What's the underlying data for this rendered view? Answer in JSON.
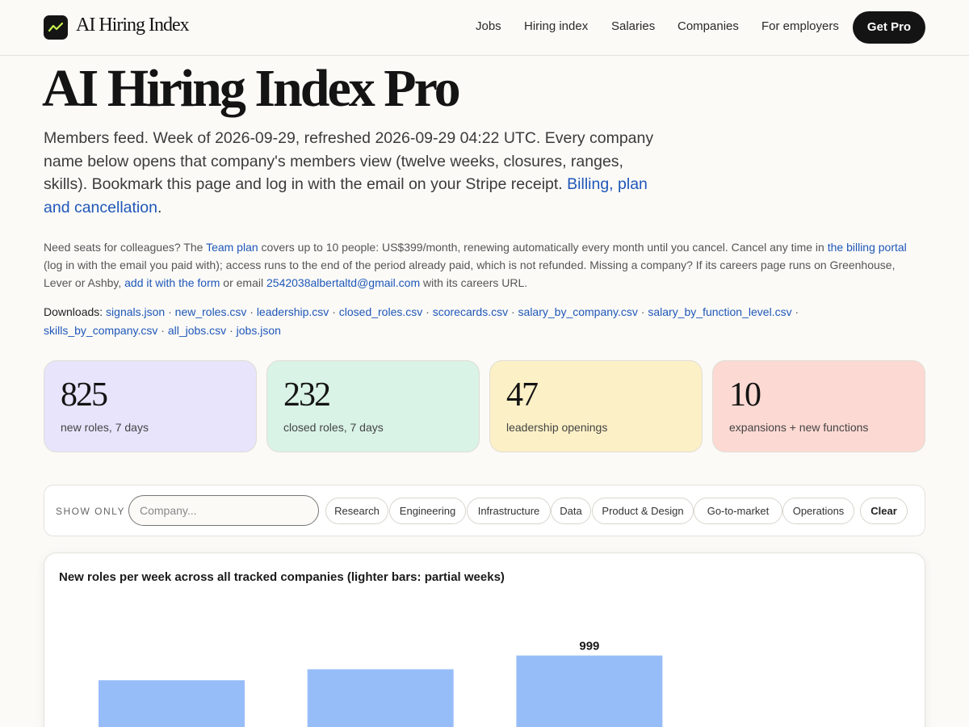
{
  "header": {
    "brand": "AI Hiring Index",
    "nav": [
      "Jobs",
      "Hiring index",
      "Salaries",
      "Companies",
      "For employers"
    ],
    "cta": "Get Pro"
  },
  "page": {
    "title": "AI Hiring Index Pro",
    "lead_text": "Members feed. Week of 2026-09-29, refreshed 2026-09-29 04:22 UTC. Every company name below opens that company's members view (twelve weeks, closures, ranges, skills). Bookmark this page and log in with the email on your Stripe receipt.",
    "lead_link": "Billing, plan and cancellation",
    "lead_end": "."
  },
  "team": {
    "t1": "Need seats for colleagues? The ",
    "team_plan_link": "Team plan",
    "t2": " covers up to 10 people: US$399/month, renewing automatically every month until you cancel. Cancel any time in ",
    "billing_portal_link": "the billing portal",
    "t3": " (log in with the email you paid with); access runs to the end of the period already paid, which is not refunded. Missing a company? If its careers page runs on Greenhouse, Lever or Ashby, ",
    "form_link": "add it with the form",
    "t4": " or email ",
    "email_link": "2542038albertaltd@gmail.com",
    "t5": " with its careers URL."
  },
  "downloads": {
    "label": "Downloads:",
    "files": [
      "signals.json",
      "new_roles.csv",
      "leadership.csv",
      "closed_roles.csv",
      "scorecards.csv",
      "salary_by_company.csv",
      "salary_by_function_level.csv",
      "skills_by_company.csv",
      "all_jobs.csv",
      "jobs.json"
    ],
    "separator": "·"
  },
  "stats": [
    {
      "value": "825",
      "label": "new roles, 7 days",
      "color": "#e7e4fc"
    },
    {
      "value": "232",
      "label": "closed roles, 7 days",
      "color": "#d9f3e6"
    },
    {
      "value": "47",
      "label": "leadership openings",
      "color": "#fcf0c6"
    },
    {
      "value": "10",
      "label": "expansions + new functions",
      "color": "#fdd9d3"
    }
  ],
  "filter": {
    "label": "SHOW ONLY",
    "company_placeholder": "Company...",
    "company_value": "",
    "functions": [
      "Research",
      "Engineering",
      "Infrastructure",
      "Data",
      "Product & Design",
      "Go-to-market",
      "Operations"
    ],
    "clear": "Clear"
  },
  "colors": {
    "accent_link": "#1f57b8",
    "bar_full": "#97bdf9",
    "logo_line": "#c6f24e"
  },
  "chart_data": {
    "type": "bar",
    "title": "New roles per week across all tracked companies (lighter bars: partial weeks)",
    "categories": [],
    "values": [
      770,
      872,
      999
    ],
    "labels": [
      "",
      "",
      "999"
    ],
    "ylim": [
      0,
      1300
    ],
    "grid": false
  }
}
